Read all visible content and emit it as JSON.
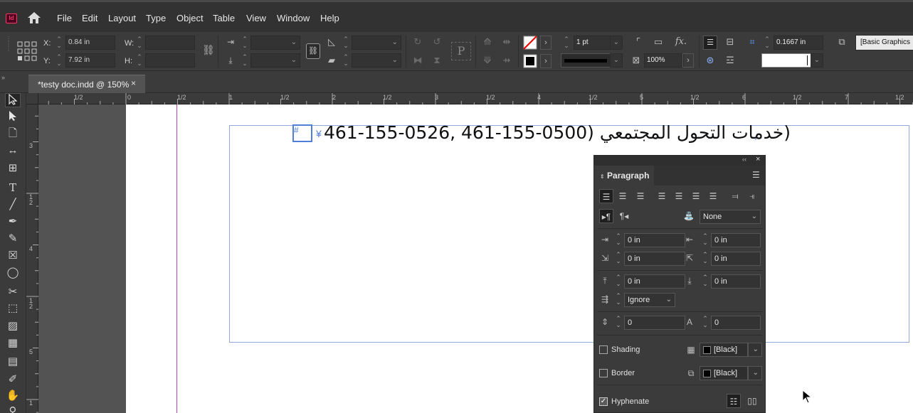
{
  "app": {
    "icon_text": "Id",
    "menu": [
      "File",
      "Edit",
      "Layout",
      "Type",
      "Object",
      "Table",
      "View",
      "Window",
      "Help"
    ]
  },
  "control": {
    "x_label": "X:",
    "x_value": "0.84 in",
    "y_label": "Y:",
    "y_value": "7.92 in",
    "w_label": "W:",
    "h_label": "H:",
    "stroke_weight": "1 pt",
    "opacity": "100%",
    "offset_value": "0.1667 in",
    "object_style": "[Basic Graphics"
  },
  "document": {
    "tab_title": "*testy doc.indd @ 150%",
    "tab_close": "×",
    "frame_text": "(خدمات التحول المجتمعي (0500-155-461 ,0526-155-461",
    "cursor_hash": "#",
    "cursor_yen": "¥",
    "para_end": "¸"
  },
  "ruler": {
    "h_ticks": [
      "1/2",
      "0",
      "1/2",
      "1",
      "1/2",
      "2",
      "1/2",
      "3",
      "1/2",
      "4",
      "1/2",
      "5",
      "1/2",
      "6",
      "1/2",
      "7",
      "1/2"
    ],
    "v_ticks": [
      "3",
      "1",
      "2",
      "4",
      "1",
      "2",
      "5",
      "1"
    ]
  },
  "paragraph_panel": {
    "title": "Paragraph",
    "language_none": "None",
    "left_indent": "0 in",
    "right_indent": "0 in",
    "first_line_indent": "0 in",
    "last_line_indent": "0 in",
    "space_before": "0 in",
    "space_after": "0 in",
    "align_to_grid": "Ignore",
    "drop_cap_lines": "0",
    "drop_cap_chars": "0",
    "shading_label": "Shading",
    "shading_color": "[Black]",
    "border_label": "Border",
    "border_color": "[Black]",
    "hyphenate_label": "Hyphenate",
    "hyphenate_checked": true
  },
  "colors": {
    "frame_border": "#8fa9d8",
    "margin_guide": "#b04ab0",
    "text_cursor": "#4f7fd8"
  }
}
